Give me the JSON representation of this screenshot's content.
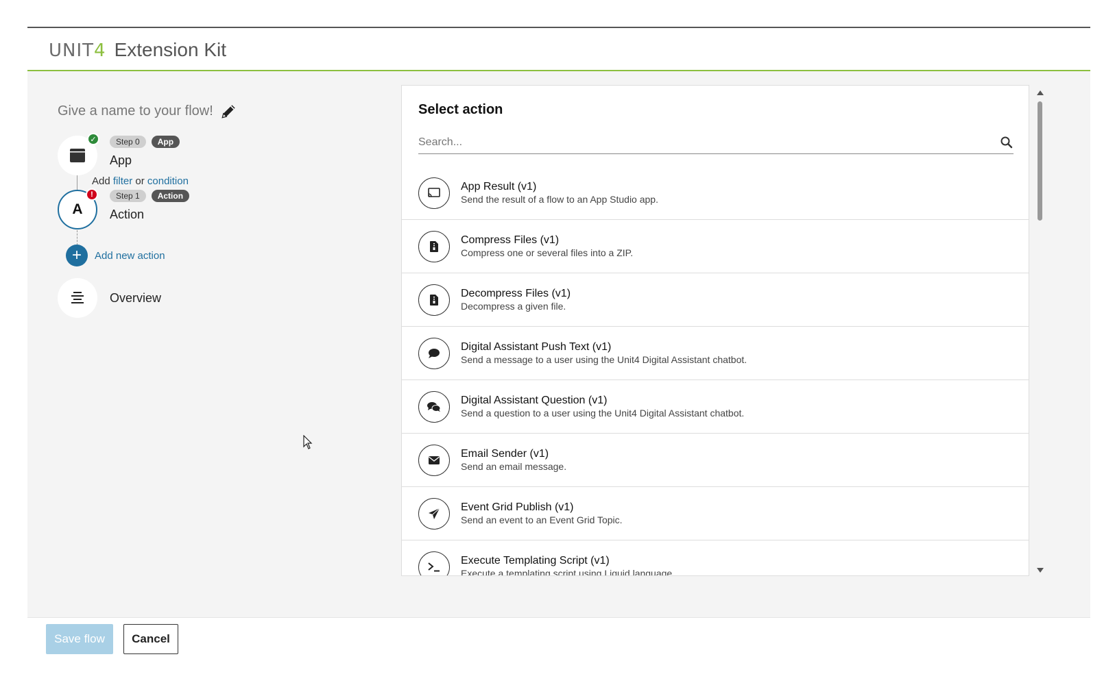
{
  "header": {
    "logo_mark": "UNIT",
    "logo_mark_four": "4",
    "app_title": "Extension Kit",
    "accent_color": "#8cbf3f"
  },
  "flow": {
    "name_placeholder": "Give a name to your flow!",
    "steps": [
      {
        "step_tag": "Step 0",
        "type_tag": "App",
        "title": "App",
        "status": "ok",
        "icon": "app-window-icon"
      },
      {
        "step_tag": "Step 1",
        "type_tag": "Action",
        "title": "Action",
        "status": "error",
        "letter": "A"
      }
    ],
    "add_filter": {
      "prefix": "Add",
      "filter": "filter",
      "or": "or",
      "condition": "condition"
    },
    "add_new_action": "Add new action",
    "overview": "Overview"
  },
  "panel": {
    "title": "Select action",
    "search_placeholder": "Search...",
    "actions": [
      {
        "name": "App Result (v1)",
        "desc": "Send the result of a flow to an App Studio app.",
        "icon": "cast-icon"
      },
      {
        "name": "Compress Files (v1)",
        "desc": "Compress one or several files into a ZIP.",
        "icon": "zip-file-icon"
      },
      {
        "name": "Decompress Files (v1)",
        "desc": "Decompress a given file.",
        "icon": "zip-file-icon"
      },
      {
        "name": "Digital Assistant Push Text (v1)",
        "desc": "Send a message to a user using the Unit4 Digital Assistant chatbot.",
        "icon": "chat-bubble-icon"
      },
      {
        "name": "Digital Assistant Question (v1)",
        "desc": "Send a question to a user using the Unit4 Digital Assistant chatbot.",
        "icon": "chat-bubbles-icon"
      },
      {
        "name": "Email Sender (v1)",
        "desc": "Send an email message.",
        "icon": "envelope-icon"
      },
      {
        "name": "Event Grid Publish (v1)",
        "desc": "Send an event to an Event Grid Topic.",
        "icon": "paper-plane-icon"
      },
      {
        "name": "Execute Templating Script (v1)",
        "desc": "Execute a templating script using Liquid language.",
        "icon": "terminal-icon"
      }
    ]
  },
  "footer": {
    "save_label": "Save flow",
    "cancel_label": "Cancel"
  },
  "colors": {
    "link": "#1f6f9f",
    "ok": "#2e8b3a",
    "error": "#d0021b",
    "save_disabled": "#a9d0e6"
  }
}
